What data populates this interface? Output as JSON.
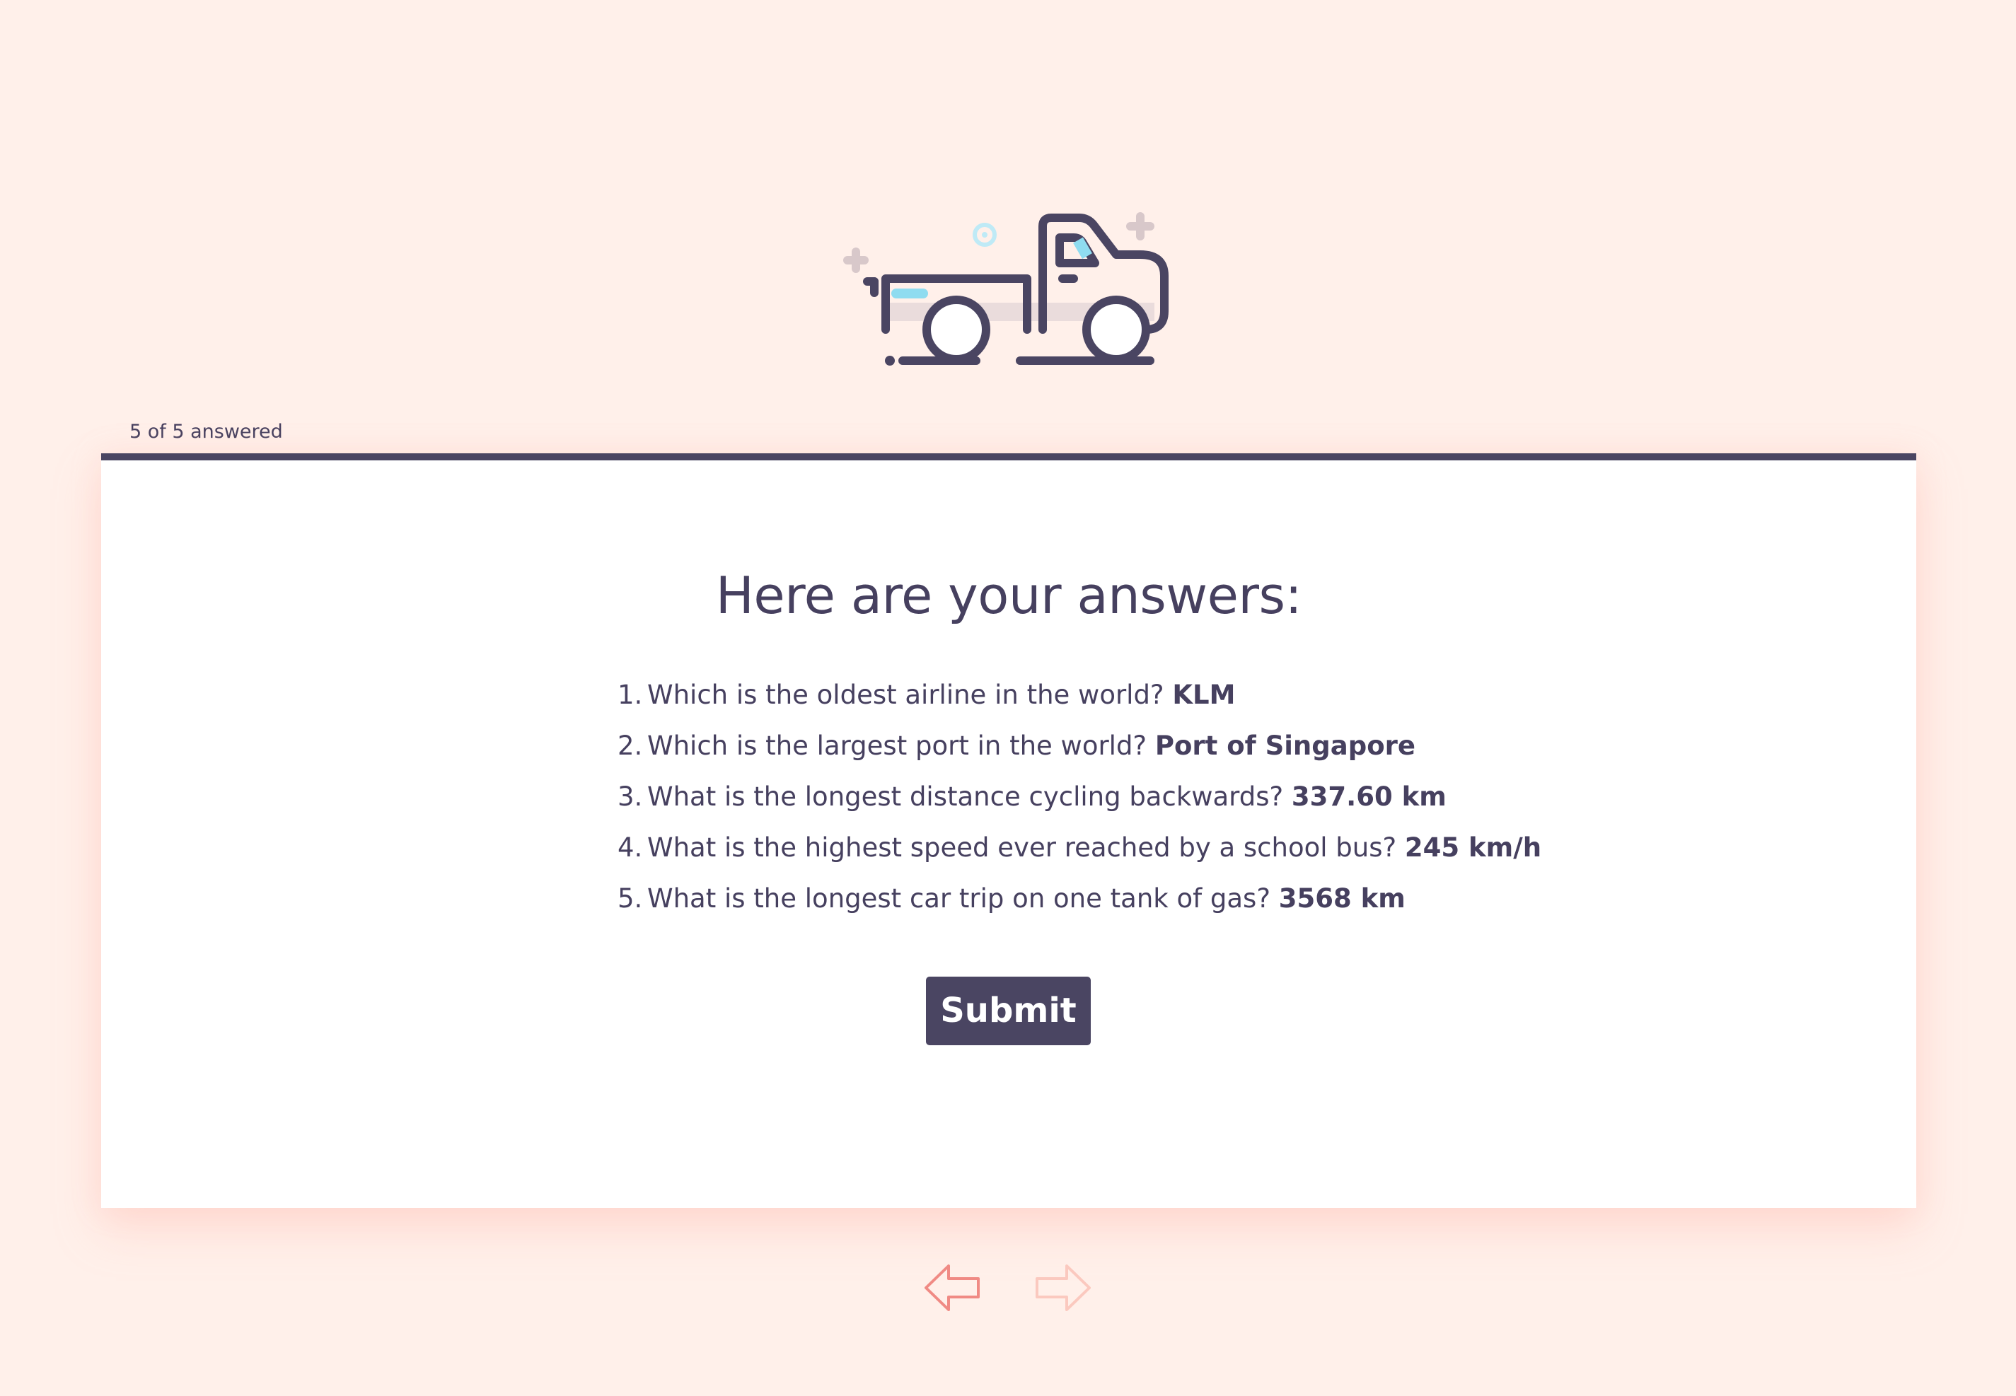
{
  "progress": {
    "label": "5 of 5 answered",
    "answered": 5,
    "total": 5
  },
  "logo": {
    "icon": "pickup-truck-icon"
  },
  "summary": {
    "title": "Here are your answers:",
    "items": [
      {
        "number": "1.",
        "question": "Which is the oldest airline in the world?",
        "answer": "KLM"
      },
      {
        "number": "2.",
        "question": "Which is the largest port in the world?",
        "answer": "Port of Singapore"
      },
      {
        "number": "3.",
        "question": "What is the longest distance cycling backwards?",
        "answer": "337.60 km"
      },
      {
        "number": "4.",
        "question": "What is the highest speed ever reached by a school bus?",
        "answer": "245 km/h"
      },
      {
        "number": "5.",
        "question": "What is the longest car trip on one tank of gas?",
        "answer": "3568 km"
      }
    ],
    "submit_label": "Submit"
  },
  "navigation": {
    "prev_icon": "arrow-left-icon",
    "next_icon": "arrow-right-icon",
    "next_enabled": false
  },
  "colors": {
    "background": "#fff0ea",
    "card": "#ffffff",
    "primary": "#4a4562",
    "text": "#46405f",
    "accent_arrow": "#f08a84",
    "accent_arrow_disabled": "#fbc9bf",
    "truck_highlight": "#8fdcf0",
    "truck_shadow": "#eadcdc"
  }
}
